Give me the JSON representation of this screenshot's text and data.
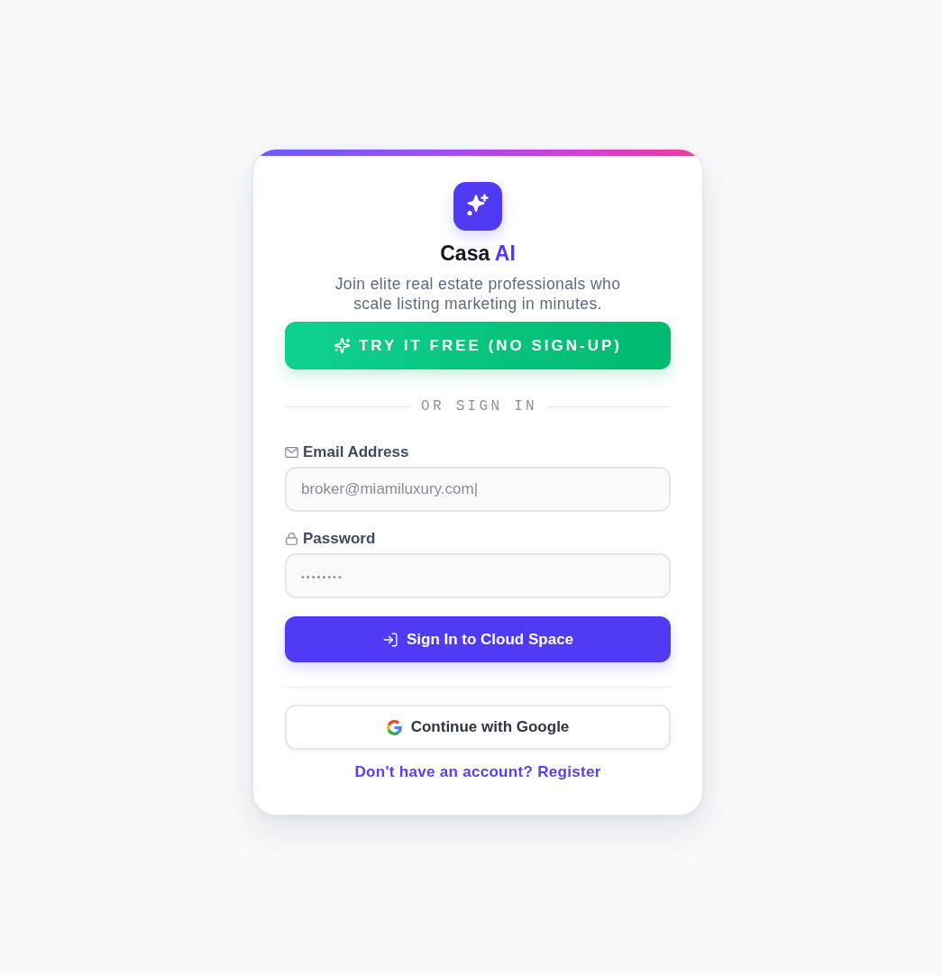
{
  "brand": {
    "title": "Casa",
    "title_accent": "AI",
    "tagline": "Join elite real estate professionals who scale listing marketing in minutes."
  },
  "trial_button": {
    "label": "TRY IT FREE (NO SIGN-UP)"
  },
  "divider": {
    "label": "OR SIGN IN"
  },
  "fields": [
    {
      "kind": "email",
      "label": "Email Address",
      "placeholder": "broker@miamiluxury.com|"
    },
    {
      "kind": "password",
      "label": "Password",
      "placeholder": "••••••••"
    }
  ],
  "sign_in_button": {
    "label": "Sign In to Cloud Space"
  },
  "google_button": {
    "label": "Continue with Google"
  },
  "register_link": {
    "label": "Don't have an account? Register"
  }
}
